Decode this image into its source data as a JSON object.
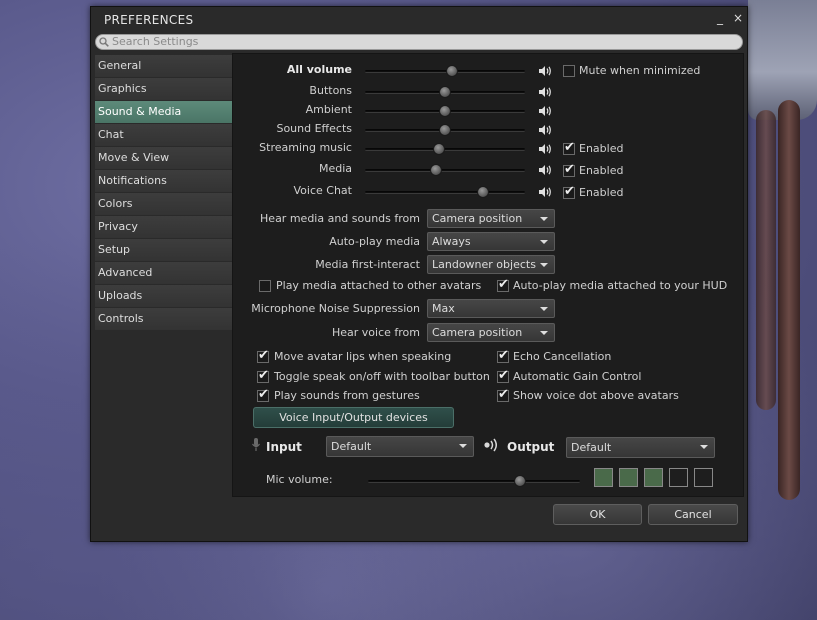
{
  "window": {
    "title": "PREFERENCES",
    "minimize_glyph": "_",
    "close_glyph": "×"
  },
  "search": {
    "placeholder": "Search Settings"
  },
  "sidebar": {
    "items": [
      {
        "label": "General"
      },
      {
        "label": "Graphics"
      },
      {
        "label": "Sound & Media",
        "active": true
      },
      {
        "label": "Chat"
      },
      {
        "label": "Move & View"
      },
      {
        "label": "Notifications"
      },
      {
        "label": "Colors"
      },
      {
        "label": "Privacy"
      },
      {
        "label": "Setup"
      },
      {
        "label": "Advanced"
      },
      {
        "label": "Uploads"
      },
      {
        "label": "Controls"
      }
    ]
  },
  "volume": {
    "all": {
      "label": "All volume",
      "level": 0.55,
      "mute_label": "Mute when minimized",
      "mute_checked": false
    },
    "buttons": {
      "label": "Buttons",
      "level": 0.5
    },
    "ambient": {
      "label": "Ambient",
      "level": 0.5
    },
    "effects": {
      "label": "Sound Effects",
      "level": 0.5
    },
    "streaming": {
      "label": "Streaming music",
      "level": 0.46,
      "enabled_label": "Enabled",
      "enabled": true
    },
    "media": {
      "label": "Media",
      "level": 0.44,
      "enabled_label": "Enabled",
      "enabled": true
    },
    "voice": {
      "label": "Voice Chat",
      "level": 0.76,
      "enabled_label": "Enabled",
      "enabled": true
    }
  },
  "media_settings": {
    "hear_media_label": "Hear media and sounds from",
    "hear_media_value": "Camera position",
    "autoplay_label": "Auto-play media",
    "autoplay_value": "Always",
    "first_interact_label": "Media first-interact",
    "first_interact_value": "Landowner objects",
    "play_attached_label": "Play media attached to other avatars",
    "play_attached_checked": false,
    "autoplay_hud_label": "Auto-play media attached to your HUD",
    "autoplay_hud_checked": true
  },
  "voice_settings": {
    "noise_label": "Microphone Noise Suppression",
    "noise_value": "Max",
    "hear_voice_label": "Hear voice from",
    "hear_voice_value": "Camera position",
    "lips_label": "Move avatar lips when speaking",
    "echo_label": "Echo Cancellation",
    "toggle_label": "Toggle speak on/off with toolbar button",
    "gain_label": "Automatic Gain Control",
    "gestures_label": "Play sounds from gestures",
    "dot_label": "Show voice dot above avatars",
    "devices_button": "Voice Input/Output devices",
    "input_label": "Input",
    "input_value": "Default",
    "output_label": "Output",
    "output_value": "Default",
    "mic_label": "Mic volume:",
    "mic_level": 0.73,
    "level_meter": [
      true,
      true,
      true,
      false,
      false
    ]
  },
  "footer": {
    "ok_label": "OK",
    "cancel_label": "Cancel"
  },
  "colors": {
    "active_tab": "#5d8a7a",
    "panel_bg": "#1d1d1d",
    "window_bg": "#2a2a2a"
  }
}
